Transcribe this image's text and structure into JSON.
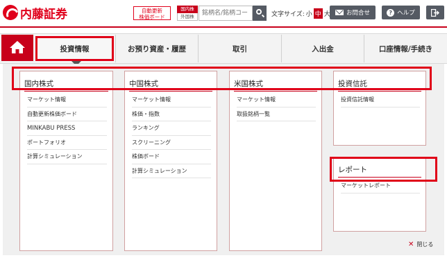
{
  "header": {
    "logo_text": "内藤証券",
    "auto_update_label": "自動更新\n株価ボード",
    "market_toggle": {
      "domestic": "国内株",
      "foreign": "外国株"
    },
    "search_placeholder": "銘柄名/銘柄コード",
    "font_size_label": "文字サイズ:",
    "font_sizes": [
      "小",
      "中",
      "大"
    ],
    "font_size_active": "中",
    "contact_label": "お問合せ",
    "help_label": "ヘルプ"
  },
  "nav": {
    "items": [
      "投資情報",
      "お預り資産・履歴",
      "取引",
      "入出金",
      "口座情報/手続き"
    ],
    "active": "投資情報"
  },
  "menu": {
    "columns": [
      {
        "title": "国内株式",
        "items": [
          "マーケット情報",
          "自動更新株価ボード",
          "MINKABU PRESS",
          "ポートフォリオ",
          "計算シミュレーション"
        ]
      },
      {
        "title": "中国株式",
        "items": [
          "マーケット情報",
          "株価・指数",
          "ランキング",
          "スクリーニング",
          "株価ボード",
          "計算シミュレーション"
        ]
      },
      {
        "title": "米国株式",
        "items": [
          "マーケット情報",
          "取扱銘柄一覧"
        ]
      },
      {
        "title": "投資信託",
        "items": [
          "投資信託情報"
        ]
      },
      {
        "title": "レポート",
        "items": [
          "マーケットレポート"
        ]
      }
    ],
    "close_label": "閉じる"
  },
  "colors": {
    "brand_red": "#c8001a",
    "highlight_red": "#e00018",
    "button_gray": "#555a63"
  }
}
